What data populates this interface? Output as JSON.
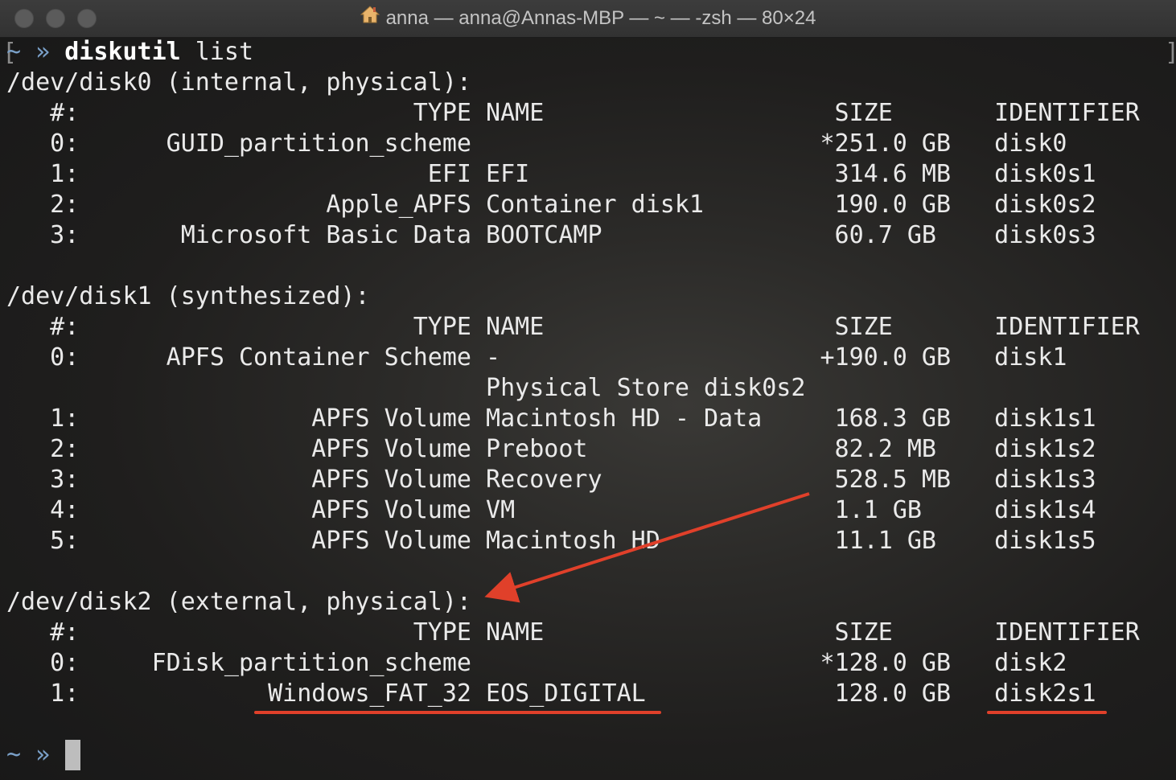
{
  "window": {
    "title": "anna — anna@Annas-MBP — ~ — -zsh — 80×24"
  },
  "terminal": {
    "prompt_symbol": "~ »",
    "command_name": "diskutil",
    "command_arg": " list",
    "lines": [
      "/dev/disk0 (internal, physical):",
      "   #:                       TYPE NAME                    SIZE       IDENTIFIER",
      "   0:      GUID_partition_scheme                        *251.0 GB   disk0",
      "   1:                        EFI EFI                     314.6 MB   disk0s1",
      "   2:                 Apple_APFS Container disk1         190.0 GB   disk0s2",
      "   3:       Microsoft Basic Data BOOTCAMP                60.7 GB    disk0s3",
      "",
      "/dev/disk1 (synthesized):",
      "   #:                       TYPE NAME                    SIZE       IDENTIFIER",
      "   0:      APFS Container Scheme -                      +190.0 GB   disk1",
      "                                 Physical Store disk0s2",
      "   1:                APFS Volume Macintosh HD - Data     168.3 GB   disk1s1",
      "   2:                APFS Volume Preboot                 82.2 MB    disk1s2",
      "   3:                APFS Volume Recovery                528.5 MB   disk1s3",
      "   4:                APFS Volume VM                      1.1 GB     disk1s4",
      "   5:                APFS Volume Macintosh HD            11.1 GB    disk1s5",
      "",
      "/dev/disk2 (external, physical):",
      "   #:                       TYPE NAME                    SIZE       IDENTIFIER",
      "   0:     FDisk_partition_scheme                        *128.0 GB   disk2",
      "   1:             Windows_FAT_32 EOS_DIGITAL             128.0 GB   disk2s1"
    ],
    "final_prompt": "~ »"
  },
  "annotations": {
    "color": "#e0402a"
  },
  "colors": {
    "text": "#eaeaea",
    "prompt": "#7aa0c8",
    "titlebar": "#363636"
  }
}
